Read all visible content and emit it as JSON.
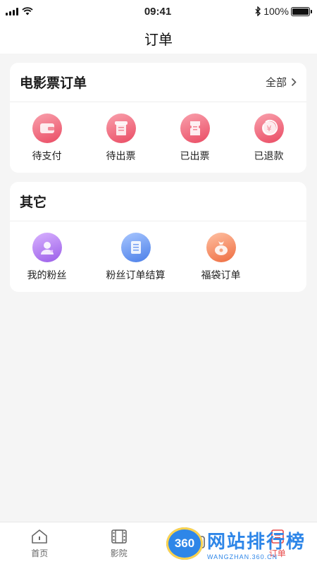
{
  "status_bar": {
    "time": "09:41",
    "battery_text": "100%"
  },
  "nav": {
    "title": "订单"
  },
  "movie_orders": {
    "title": "电影票订单",
    "more_label": "全部",
    "items": [
      {
        "label": "待支付",
        "icon": "wallet-icon",
        "color": "#ef5a6f"
      },
      {
        "label": "待出票",
        "icon": "ticket-list-icon",
        "color": "#ef5a6f"
      },
      {
        "label": "已出票",
        "icon": "ticket-issued-icon",
        "color": "#ef5a6f"
      },
      {
        "label": "已退款",
        "icon": "refund-icon",
        "color": "#ef5a6f"
      }
    ]
  },
  "other": {
    "title": "其它",
    "items": [
      {
        "label": "我的粉丝",
        "icon": "fans-icon",
        "color": "#a86cf0"
      },
      {
        "label": "粉丝订单结算",
        "icon": "settlement-icon",
        "color": "#4f86ee"
      },
      {
        "label": "福袋订单",
        "icon": "lucky-bag-icon",
        "color": "#f07a4a"
      }
    ]
  },
  "tabbar": {
    "items": [
      {
        "label": "首页",
        "icon": "home-icon"
      },
      {
        "label": "影院",
        "icon": "cinema-icon"
      },
      {
        "label": "",
        "icon": "discover-icon"
      },
      {
        "label": "订单",
        "icon": "order-icon",
        "active": true
      }
    ]
  },
  "watermark": {
    "badge": "360",
    "title": "网站排行榜",
    "sub": "WANGZHAN.360.CN"
  }
}
